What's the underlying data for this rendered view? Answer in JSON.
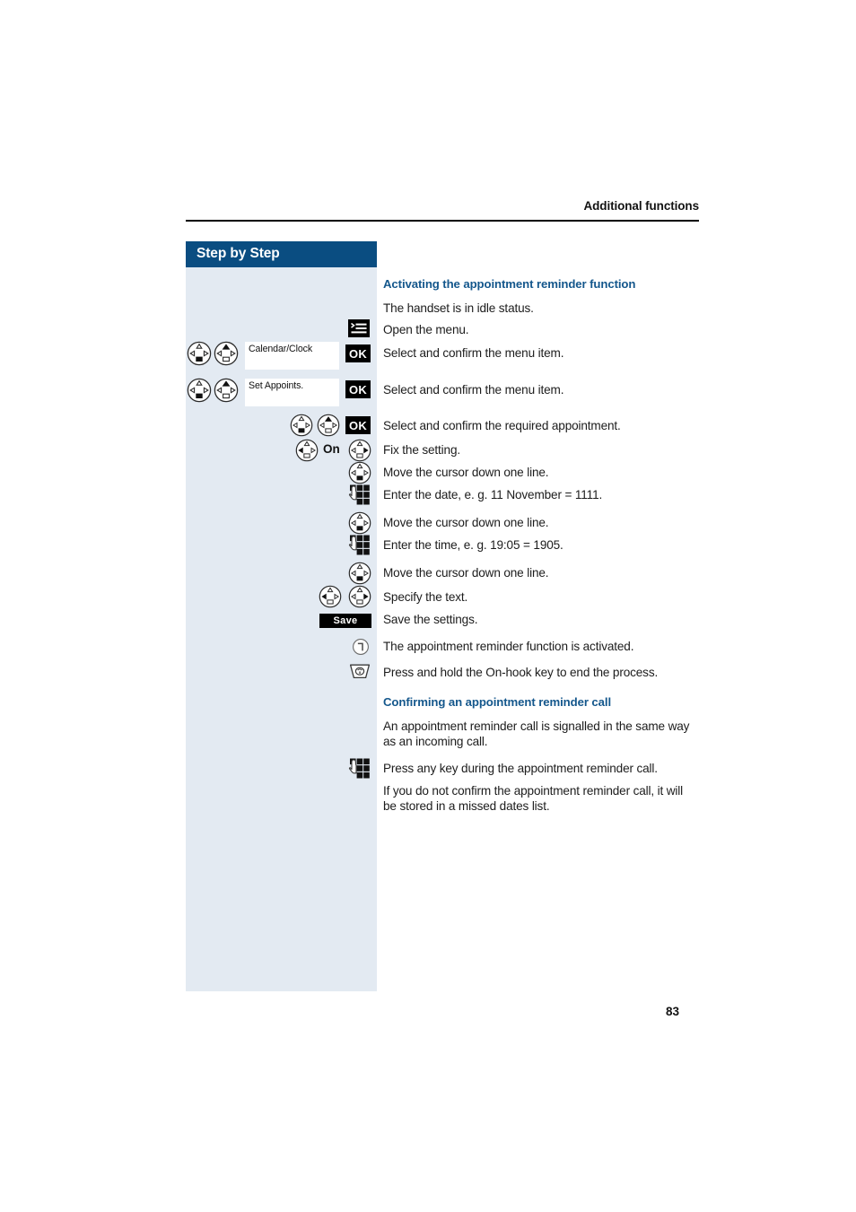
{
  "header": {
    "running_title": "Additional functions"
  },
  "sidebar": {
    "title": "Step by Step"
  },
  "page_number": "83",
  "sections": [
    {
      "heading": "Activating the appointment reminder function"
    },
    {
      "heading": "Confirming an appointment reminder call"
    }
  ],
  "steps": [
    {
      "icon": "none",
      "text": "The handset is in idle status."
    },
    {
      "icon": "menu-key",
      "text": "Open the menu."
    },
    {
      "icon": "nav-pair-down-up",
      "field": "Calendar/Clock",
      "button": "OK",
      "text": "Select and confirm the menu item."
    },
    {
      "icon": "nav-pair-down-up",
      "field": "Set Appoints.",
      "button": "OK",
      "text": "Select and confirm the menu item."
    },
    {
      "icon": "nav-pair-down-up",
      "button": "OK",
      "text": "Select and confirm the required appointment."
    },
    {
      "icon": "nav-pair-left-right",
      "middle_label": "On",
      "text": "Fix the setting."
    },
    {
      "icon": "nav-down",
      "text": "Move the cursor down one line."
    },
    {
      "icon": "keypad",
      "text": "Enter the date, e. g. 11 November = 1111."
    },
    {
      "icon": "nav-down",
      "text": "Move the cursor down one line."
    },
    {
      "icon": "keypad",
      "text": "Enter the time, e. g. 19:05 = 1905."
    },
    {
      "icon": "nav-down",
      "text": "Move the cursor down one line."
    },
    {
      "icon": "nav-pair-left-right",
      "text": "Specify the text."
    },
    {
      "icon": "save-key",
      "button": "Save",
      "text": "Save the settings."
    },
    {
      "icon": "reminder-clock",
      "text": "The appointment reminder function is activated."
    },
    {
      "icon": "on-hook-key",
      "text": "Press and hold the On-hook key to end the process."
    },
    {
      "icon": "none",
      "text": "An appointment reminder call is signalled in the same way as an incoming call."
    },
    {
      "icon": "keypad",
      "text": "Press any key during the appointment reminder call."
    },
    {
      "icon": "none",
      "text": "If you do not confirm the appointment reminder call, it will be stored in a missed dates list."
    }
  ],
  "colors": {
    "heading_blue": "#14578c",
    "sidebar_bg": "#e3eaf2",
    "title_bar": "#0a4d81",
    "key_black": "#000000"
  }
}
